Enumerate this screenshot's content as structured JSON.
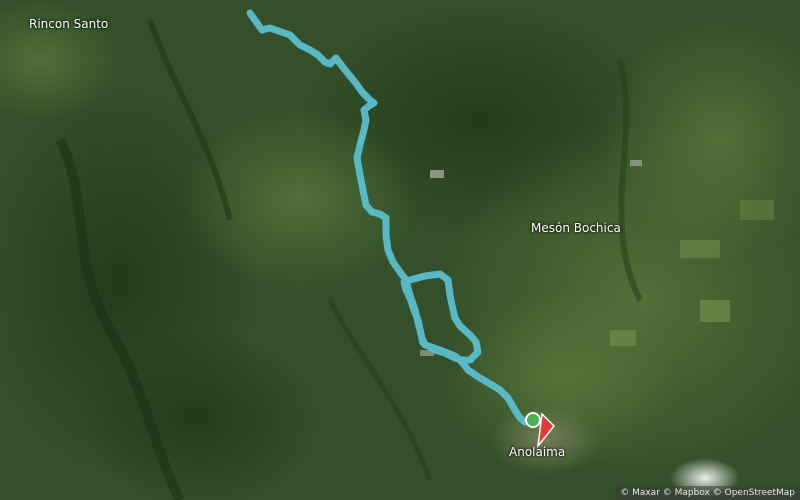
{
  "map": {
    "style": "satellite",
    "places": [
      {
        "name": "Rincon Santo"
      },
      {
        "name": "Mesón Bochica"
      },
      {
        "name": "Anolaima"
      }
    ],
    "route": {
      "color": "#5cc4d6"
    },
    "markers": {
      "start_color": "#4caf50",
      "end_color": "#e53935"
    },
    "attribution": "© Maxar © Mapbox © OpenStreetMap"
  }
}
